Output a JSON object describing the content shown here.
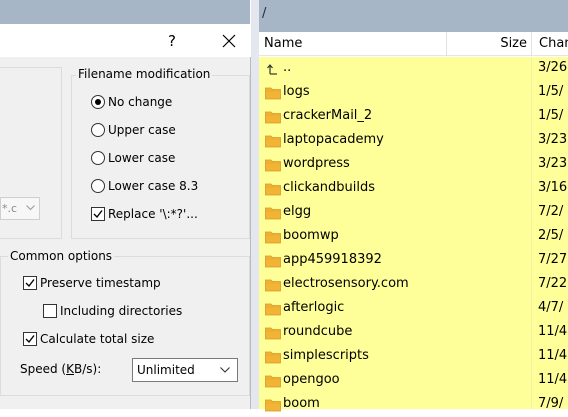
{
  "dialog": {
    "help_label": "?",
    "filename_group": {
      "title": "Filename modification",
      "options": [
        {
          "label": "No change",
          "selected": true
        },
        {
          "label": "Upper case",
          "selected": false
        },
        {
          "label": "Lower case",
          "selected": false
        },
        {
          "label": "Lower case 8.3",
          "selected": false
        }
      ],
      "replace_label": "Replace '\\:*?'...",
      "replace_checked": true
    },
    "partial_combo_text": "*.c",
    "common_group": {
      "title": "Common options",
      "preserve_timestamp": {
        "label": "Preserve timestamp",
        "checked": true
      },
      "including_directories": {
        "label": "Including directories",
        "checked": false
      },
      "calculate_total_size": {
        "label": "Calculate total size",
        "checked": true
      },
      "speed_label_pre": "Speed (",
      "speed_label_key": "K",
      "speed_label_post": "B/s):",
      "speed_value": "Unlimited"
    }
  },
  "remote": {
    "path": "/",
    "columns": {
      "name": "Name",
      "size": "Size",
      "changed": "Chan"
    },
    "files": [
      {
        "name": "..",
        "changed": "3/26",
        "type": "parent"
      },
      {
        "name": "logs",
        "changed": "1/5/",
        "type": "folder"
      },
      {
        "name": "crackerMail_2",
        "changed": "1/5/",
        "type": "folder"
      },
      {
        "name": "laptopacademy",
        "changed": "3/23",
        "type": "folder"
      },
      {
        "name": "wordpress",
        "changed": "3/23",
        "type": "folder"
      },
      {
        "name": "clickandbuilds",
        "changed": "3/16",
        "type": "folder"
      },
      {
        "name": "elgg",
        "changed": "7/2/",
        "type": "folder"
      },
      {
        "name": "boomwp",
        "changed": "2/5/",
        "type": "folder"
      },
      {
        "name": "app459918392",
        "changed": "7/27",
        "type": "folder"
      },
      {
        "name": "electrosensory.com",
        "changed": "7/22",
        "type": "folder"
      },
      {
        "name": "afterlogic",
        "changed": "4/7/",
        "type": "folder"
      },
      {
        "name": "roundcube",
        "changed": "11/4",
        "type": "folder"
      },
      {
        "name": "simplescripts",
        "changed": "11/4",
        "type": "folder"
      },
      {
        "name": "opengoo",
        "changed": "11/4",
        "type": "folder"
      },
      {
        "name": "boom",
        "changed": "7/9/",
        "type": "folder"
      }
    ]
  },
  "colors": {
    "list_background": "#ffff99",
    "folder": "#f2b436",
    "path_bar": "#a7b6c7"
  }
}
